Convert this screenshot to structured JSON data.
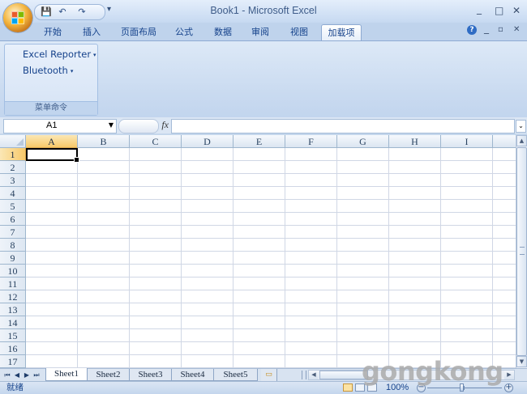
{
  "window": {
    "title": "Book1 - Microsoft Excel",
    "minimize": "_",
    "restore": "□",
    "close": "✕",
    "wb_minimize": "_",
    "wb_restore": "▫",
    "wb_close": "✕",
    "help": "?"
  },
  "qat": {
    "save": "💾",
    "undo": "↶",
    "redo": "↷",
    "more": "▾"
  },
  "ribbon": {
    "tabs": [
      "开始",
      "插入",
      "页面布局",
      "公式",
      "数据",
      "审阅",
      "视图",
      "加载项"
    ],
    "active_tab": "加载项",
    "group": {
      "label": "菜单命令",
      "items": [
        {
          "label": "Excel Reporter",
          "arrow": "▾"
        },
        {
          "label": "Bluetooth",
          "arrow": "▾"
        }
      ]
    }
  },
  "formula_bar": {
    "name_box": "A1",
    "fx": "fx",
    "value": ""
  },
  "grid": {
    "columns": [
      "A",
      "B",
      "C",
      "D",
      "E",
      "F",
      "G",
      "H",
      "I"
    ],
    "rows": [
      "1",
      "2",
      "3",
      "4",
      "5",
      "6",
      "7",
      "8",
      "9",
      "10",
      "11",
      "12",
      "13",
      "14",
      "15",
      "16",
      "17"
    ],
    "selected_cell": "A1"
  },
  "sheets": {
    "tabs": [
      "Sheet1",
      "Sheet2",
      "Sheet3",
      "Sheet4",
      "Sheet5"
    ],
    "active": "Sheet1",
    "nav": [
      "⏮",
      "◀",
      "▶",
      "⏭"
    ]
  },
  "status": {
    "text": "就绪",
    "zoom": "100%",
    "zoom_level_percent": 100
  },
  "watermark": "gongkong"
}
